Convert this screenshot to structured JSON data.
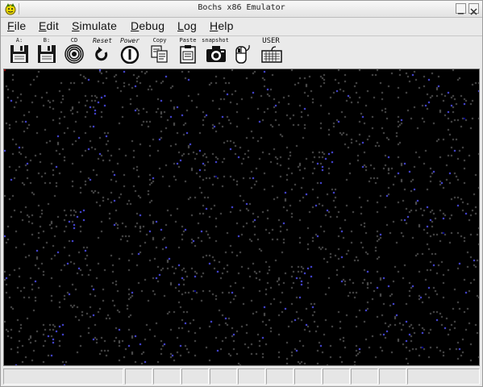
{
  "window": {
    "title": "Bochs x86 Emulator"
  },
  "menu": {
    "items": [
      {
        "label": "File",
        "mnemonic": "F",
        "rest": "ile"
      },
      {
        "label": "Edit",
        "mnemonic": "E",
        "rest": "dit"
      },
      {
        "label": "Simulate",
        "mnemonic": "S",
        "rest": "imulate"
      },
      {
        "label": "Debug",
        "mnemonic": "D",
        "rest": "ebug"
      },
      {
        "label": "Log",
        "mnemonic": "L",
        "rest": "og"
      },
      {
        "label": "Help",
        "mnemonic": "H",
        "rest": "elp"
      }
    ]
  },
  "toolbar": {
    "floppy_a": {
      "label": "A:",
      "icon": "floppy-disk-icon"
    },
    "floppy_b": {
      "label": "B:",
      "icon": "floppy-disk-icon"
    },
    "cdrom": {
      "label": "CD",
      "icon": "cdrom-icon"
    },
    "reset": {
      "label": "Reset",
      "icon": "reset-icon"
    },
    "power": {
      "label": "Power",
      "icon": "power-icon"
    },
    "copy": {
      "label": "Copy",
      "icon": "copy-icon"
    },
    "paste": {
      "label": "Paste",
      "icon": "paste-icon"
    },
    "snapshot": {
      "label": "snapshot",
      "icon": "camera-icon"
    },
    "mouse": {
      "label": "",
      "icon": "mouse-icon"
    },
    "user": {
      "label": "USER",
      "icon": "keyboard-icon"
    }
  },
  "status": {
    "cells": [
      "",
      "",
      "",
      "",
      "",
      "",
      "",
      "",
      "",
      "",
      "",
      "",
      ""
    ]
  },
  "colors": {
    "accent": "#8fa818",
    "screen_bg": "#444444"
  }
}
